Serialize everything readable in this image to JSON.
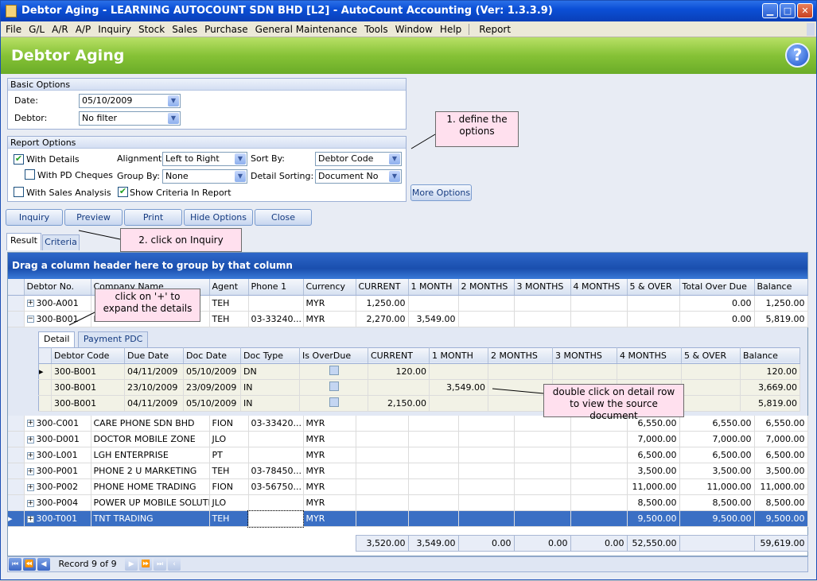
{
  "window": {
    "title": "Debtor Aging - LEARNING AUTOCOUNT SDN BHD [L2] - AutoCount Accounting (Ver: 1.3.3.9)"
  },
  "menu": [
    "File",
    "G/L",
    "A/R",
    "A/P",
    "Inquiry",
    "Stock",
    "Sales",
    "Purchase",
    "General Maintenance",
    "Tools",
    "Window",
    "Help",
    "Report"
  ],
  "page_title": "Debtor Aging",
  "help_label": "?",
  "basic": {
    "header": "Basic Options",
    "date_label": "Date:",
    "date_value": "05/10/2009",
    "debtor_label": "Debtor:",
    "debtor_value": "No filter"
  },
  "report": {
    "header": "Report Options",
    "with_details": "With Details",
    "with_pd": "With PD Cheques",
    "with_sales": "With Sales Analysis",
    "alignment_label": "Alignment:",
    "alignment_value": "Left to Right",
    "groupby_label": "Group By:",
    "groupby_value": "None",
    "show_criteria": "Show Criteria In Report",
    "sortby_label": "Sort By:",
    "sortby_value": "Debtor Code",
    "detailsort_label": "Detail Sorting:",
    "detailsort_value": "Document No"
  },
  "more_options": "More Options",
  "buttons": {
    "inquiry": "Inquiry",
    "preview": "Preview",
    "print": "Print",
    "hide": "Hide Options",
    "close": "Close"
  },
  "tabs": {
    "result": "Result",
    "criteria": "Criteria"
  },
  "callouts": {
    "c1": "1. define the options",
    "c2": "2. click on Inquiry",
    "c3": "click on '+' to expand the details",
    "c4": "double click on detail row to view the source document"
  },
  "grid": {
    "group_panel": "Drag a column header here to group by that column",
    "columns": [
      "Debtor No.",
      "Company Name",
      "Agent",
      "Phone 1",
      "Currency",
      "CURRENT",
      "1 MONTH",
      "2 MONTHS",
      "3 MONTHS",
      "4 MONTHS",
      "5 & OVER",
      "Total Over Due",
      "Balance"
    ],
    "rows_top": [
      {
        "no": "300-A001",
        "name": "",
        "agent": "TEH",
        "phone": "",
        "cur": "MYR",
        "current": "1,250.00",
        "m1": "",
        "m2": "",
        "m3": "",
        "m4": "",
        "m5": "",
        "total": "0.00",
        "bal": "1,250.00",
        "sign": "+"
      },
      {
        "no": "300-B001",
        "name": "BEST PHONE SDN BHD",
        "agent": "TEH",
        "phone": "03-33240...",
        "cur": "MYR",
        "current": "2,270.00",
        "m1": "3,549.00",
        "m2": "",
        "m3": "",
        "m4": "",
        "m5": "",
        "total": "0.00",
        "bal": "5,819.00",
        "sign": "−"
      }
    ],
    "detail_tabs": [
      "Detail",
      "Payment PDC"
    ],
    "detail_columns": [
      "Debtor Code",
      "Due Date",
      "Doc Date",
      "Doc Type",
      "Is OverDue",
      "CURRENT",
      "1 MONTH",
      "2 MONTHS",
      "3 MONTHS",
      "4 MONTHS",
      "5 & OVER",
      "Balance"
    ],
    "detail_rows": [
      {
        "code": "300-B001",
        "due": "04/11/2009",
        "doc": "05/10/2009",
        "type": "DN",
        "current": "120.00",
        "m1": "",
        "bal": "120.00"
      },
      {
        "code": "300-B001",
        "due": "23/10/2009",
        "doc": "23/09/2009",
        "type": "IN",
        "current": "",
        "m1": "3,549.00",
        "bal": "3,669.00"
      },
      {
        "code": "300-B001",
        "due": "04/11/2009",
        "doc": "05/10/2009",
        "type": "IN",
        "current": "2,150.00",
        "m1": "",
        "bal": "5,819.00"
      }
    ],
    "rows_bottom": [
      {
        "no": "300-C001",
        "name": "CARE PHONE SDN BHD",
        "agent": "FION",
        "phone": "03-33420...",
        "cur": "MYR",
        "m5": "6,550.00",
        "total": "6,550.00",
        "bal": "6,550.00"
      },
      {
        "no": "300-D001",
        "name": "DOCTOR MOBILE ZONE",
        "agent": "JLO",
        "phone": "",
        "cur": "MYR",
        "m5": "7,000.00",
        "total": "7,000.00",
        "bal": "7,000.00"
      },
      {
        "no": "300-L001",
        "name": "LGH ENTERPRISE",
        "agent": "PT",
        "phone": "",
        "cur": "MYR",
        "m5": "6,500.00",
        "total": "6,500.00",
        "bal": "6,500.00"
      },
      {
        "no": "300-P001",
        "name": "PHONE 2 U MARKETING",
        "agent": "TEH",
        "phone": "03-78450...",
        "cur": "MYR",
        "m5": "3,500.00",
        "total": "3,500.00",
        "bal": "3,500.00"
      },
      {
        "no": "300-P002",
        "name": "PHONE HOME TRADING",
        "agent": "FION",
        "phone": "03-56750...",
        "cur": "MYR",
        "m5": "11,000.00",
        "total": "11,000.00",
        "bal": "11,000.00"
      },
      {
        "no": "300-P004",
        "name": "POWER UP MOBILE SOLUTI...",
        "agent": "JLO",
        "phone": "",
        "cur": "MYR",
        "m5": "8,500.00",
        "total": "8,500.00",
        "bal": "8,500.00"
      },
      {
        "no": "300-T001",
        "name": "TNT TRADING",
        "agent": "TEH",
        "phone": "",
        "cur": "MYR",
        "m5": "9,500.00",
        "total": "9,500.00",
        "bal": "9,500.00"
      }
    ],
    "summary": {
      "current": "3,520.00",
      "m1": "3,549.00",
      "m2": "0.00",
      "m3": "0.00",
      "m4": "0.00",
      "m5": "52,550.00",
      "bal": "59,619.00"
    },
    "record": "Record 9 of 9"
  }
}
